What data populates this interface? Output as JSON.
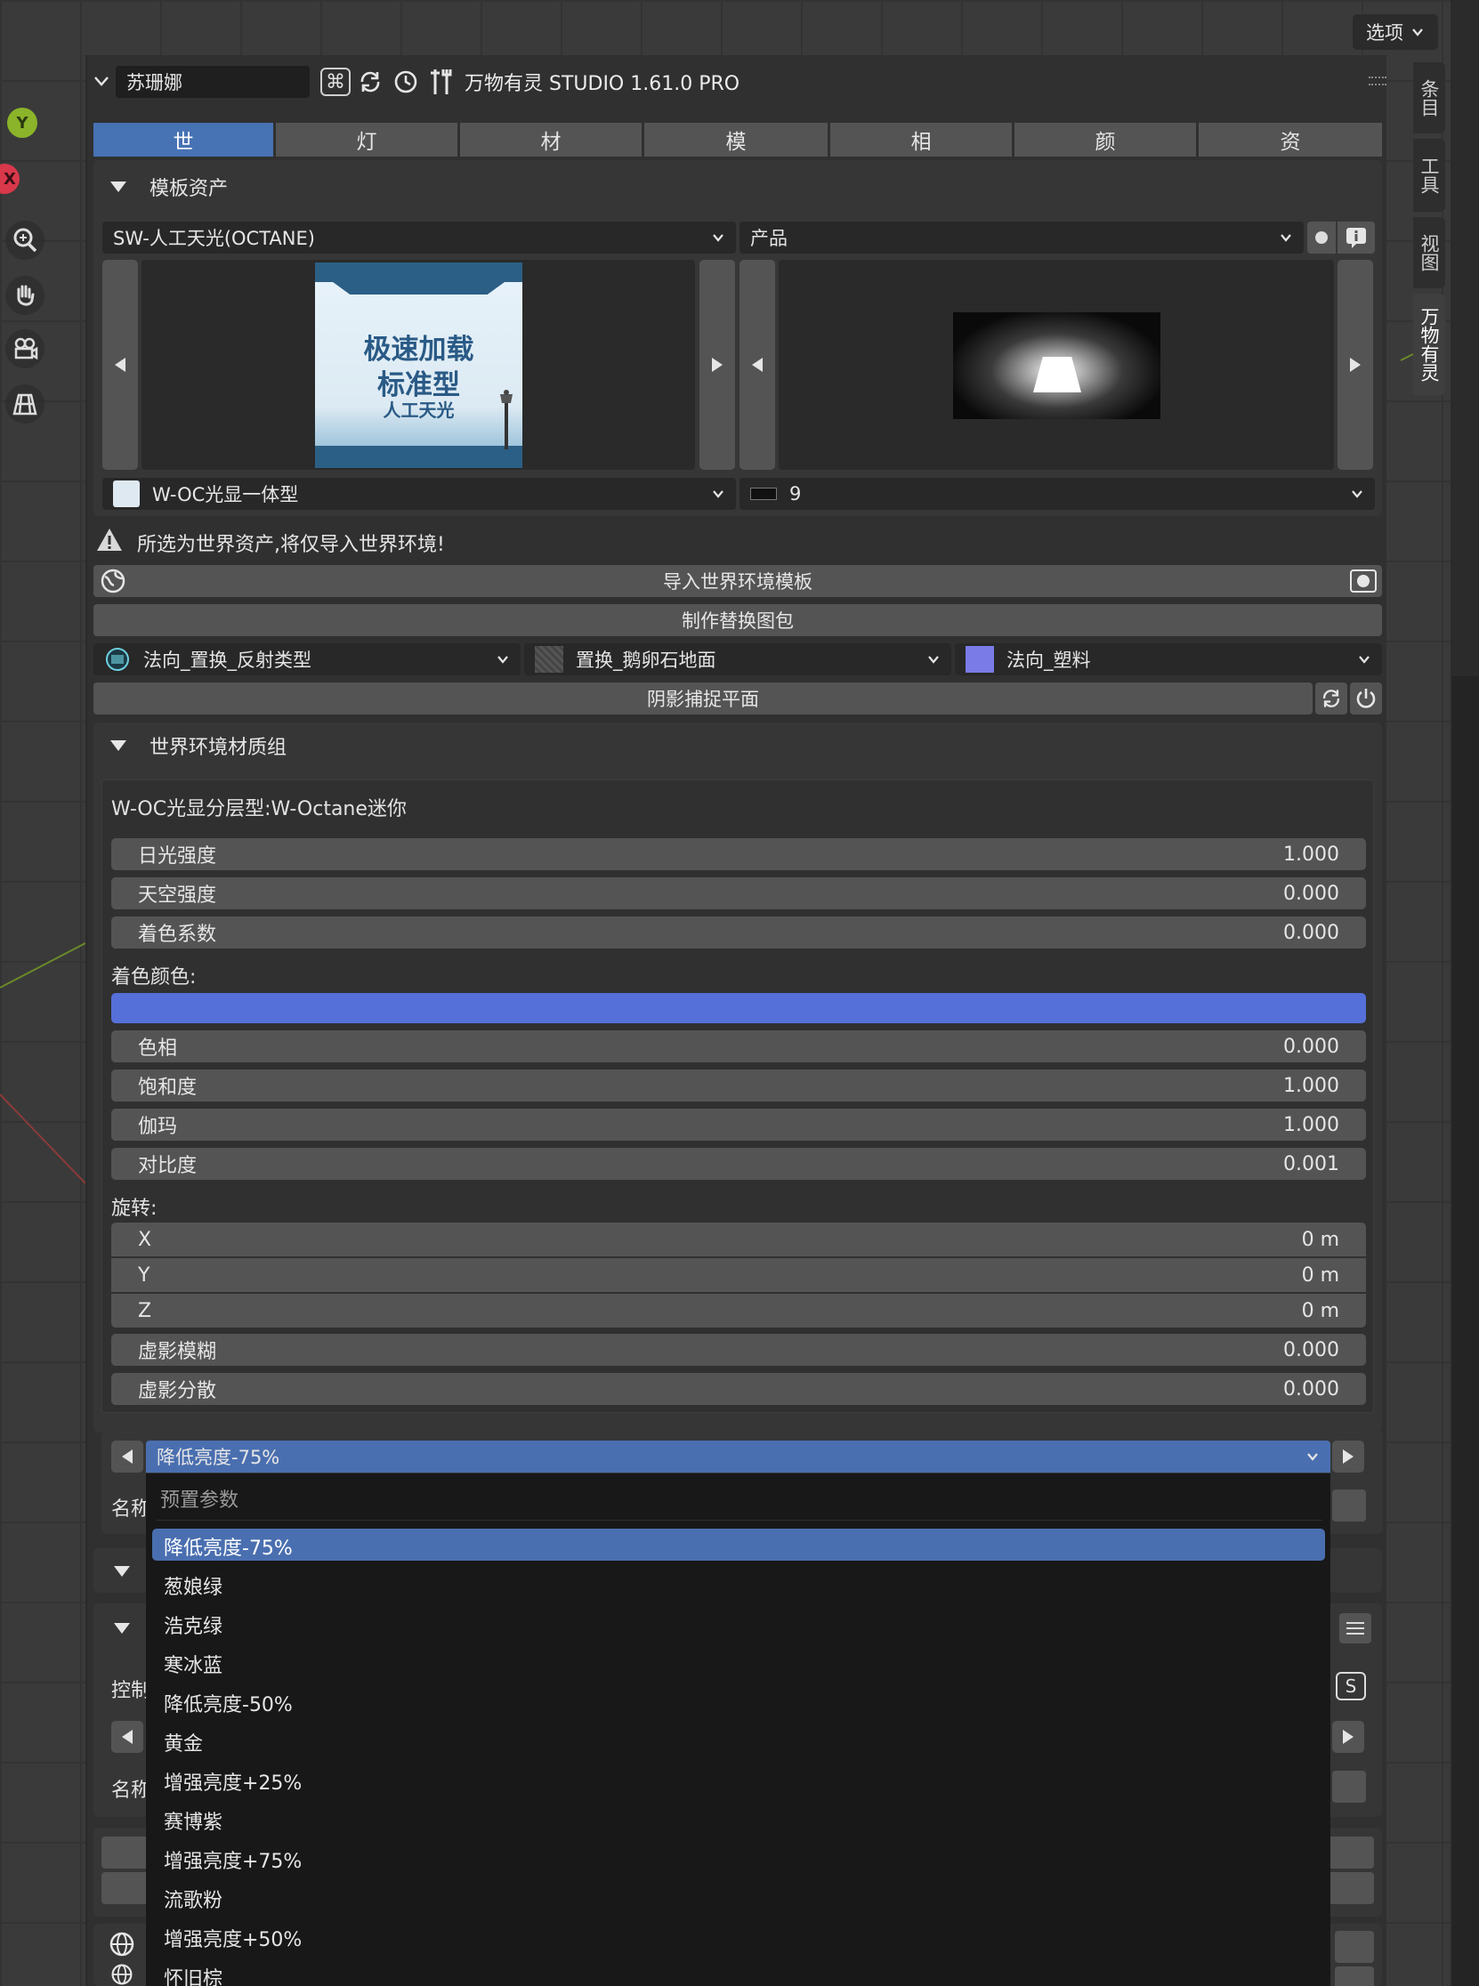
{
  "header": {
    "options_label": "选项",
    "name_field": "苏珊娜",
    "addon_title": "万物有灵 STUDIO 1.61.0 PRO"
  },
  "gizmo": {
    "y_label": "Y",
    "x_label": "X"
  },
  "tabs": [
    {
      "label": "世",
      "active": true
    },
    {
      "label": "灯",
      "active": false
    },
    {
      "label": "材",
      "active": false
    },
    {
      "label": "模",
      "active": false
    },
    {
      "label": "相",
      "active": false
    },
    {
      "label": "颜",
      "active": false
    },
    {
      "label": "资",
      "active": false
    }
  ],
  "template_assets": {
    "title": "模板资产",
    "left_dropdown": "SW-人工天光(OCTANE)",
    "right_dropdown": "产品",
    "thumb_text": {
      "line1": "极速加载",
      "line2": "标准型",
      "line3": "人工天光"
    },
    "left_asset": "W-OC光显一体型",
    "right_asset": "9",
    "warning": "所选为世界资产,将仅导入世界环境!",
    "import_button": "导入世界环境模板",
    "make_pack_button": "制作替换图包",
    "material_slots": [
      "法向_置换_反射类型",
      "置换_鹅卵石地面",
      "法向_塑料"
    ],
    "shadow_catcher": "阴影捕捉平面"
  },
  "world_material": {
    "title": "世界环境材质组",
    "subtitle": "W-OC光显分层型:W-Octane迷你",
    "fields_a": [
      {
        "label": "日光强度",
        "value": "1.000"
      },
      {
        "label": "天空强度",
        "value": "0.000"
      },
      {
        "label": "着色系数",
        "value": "0.000"
      }
    ],
    "tint_color_label": "着色颜色:",
    "tint_color": "#5570d8",
    "fields_b": [
      {
        "label": "色相",
        "value": "0.000"
      },
      {
        "label": "饱和度",
        "value": "1.000"
      },
      {
        "label": "伽玛",
        "value": "1.000"
      },
      {
        "label": "对比度",
        "value": "0.001"
      }
    ],
    "rotation_label": "旋转:",
    "rotation": [
      {
        "label": "X",
        "value": "0 m"
      },
      {
        "label": "Y",
        "value": "0 m"
      },
      {
        "label": "Z",
        "value": "0 m"
      }
    ],
    "fields_c": [
      {
        "label": "虚影模糊",
        "value": "0.000"
      },
      {
        "label": "虚影分散",
        "value": "0.000"
      }
    ]
  },
  "preset": {
    "selected": "降低亮度-75%",
    "name_label": "名称",
    "control_label": "控制",
    "name_label_2": "名称",
    "menu_header": "预置参数",
    "items": [
      "降低亮度-75%",
      "葱娘绿",
      "浩克绿",
      "寒冰蓝",
      "降低亮度-50%",
      "黄金",
      "增强亮度+25%",
      "赛博紫",
      "增强亮度+75%",
      "流歌粉",
      "增强亮度+50%",
      "怀旧棕"
    ]
  },
  "side_tabs": [
    "条目",
    "工具",
    "视图",
    "万物有灵"
  ],
  "colors": {
    "accent": "#4772b3",
    "highlight": "#4a6fb0",
    "tint": "#5570d8",
    "slot3": "#7b7be8"
  }
}
